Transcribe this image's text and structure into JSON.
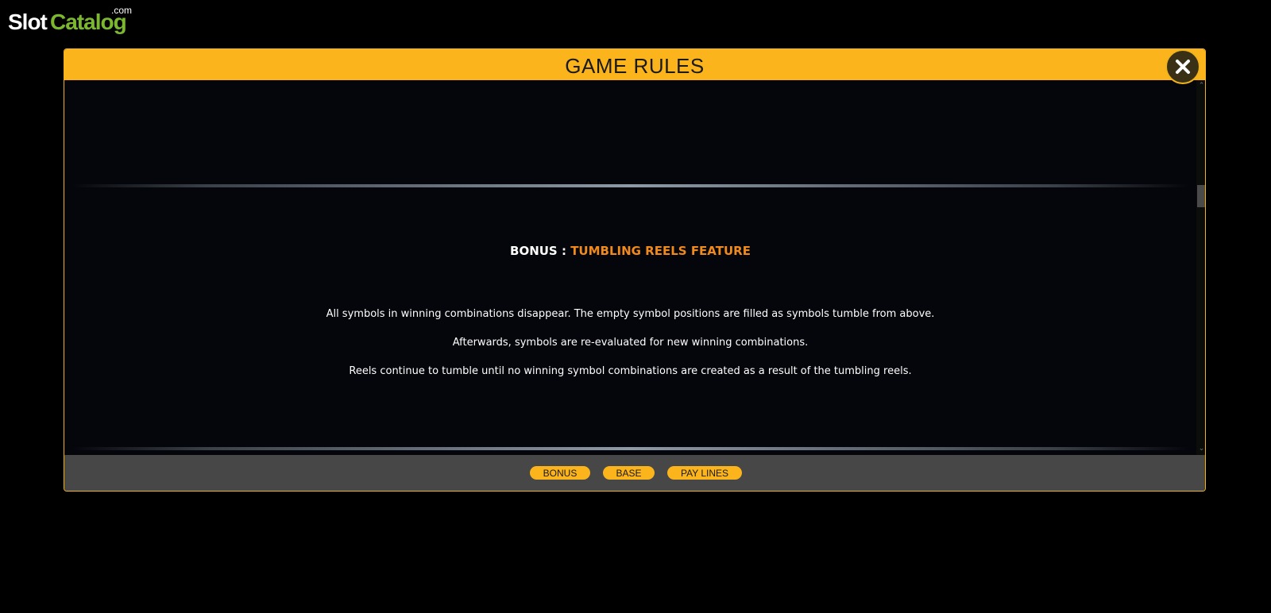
{
  "logo": {
    "part1": "Slot",
    "part2": "Catalog",
    "suffix": ".com"
  },
  "modal": {
    "title": "GAME RULES",
    "close_icon": "close-icon"
  },
  "content": {
    "heading_prefix": "BONUS : ",
    "heading_feature": "TUMBLING REELS FEATURE",
    "paragraphs": [
      "All symbols in winning combinations disappear. The empty symbol positions are filled as symbols tumble from above.",
      "Afterwards, symbols are re-evaluated for new winning combinations.",
      "Reels continue to tumble until no winning symbol combinations are created as a result of the tumbling reels."
    ]
  },
  "tabs": [
    {
      "label": "BONUS"
    },
    {
      "label": "BASE"
    },
    {
      "label": "PAY LINES"
    }
  ],
  "colors": {
    "accent": "#fbb41c",
    "feature_text": "#f08a1c",
    "logo_green": "#7cb82f",
    "footer": "#474747"
  }
}
